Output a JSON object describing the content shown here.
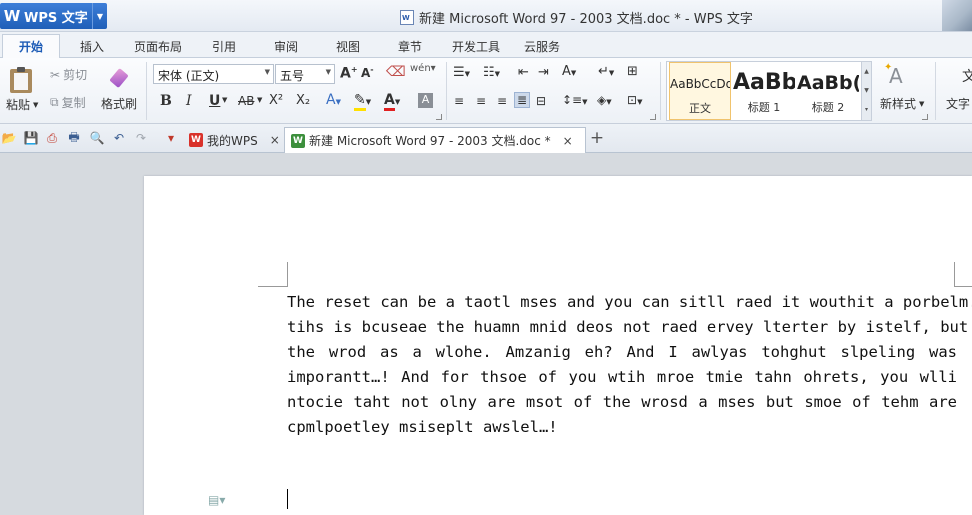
{
  "app": {
    "brand_logo": "W",
    "brand_name": "WPS 文字",
    "window_title": "新建 Microsoft Word 97 - 2003 文档.doc * - WPS 文字"
  },
  "menu": {
    "tabs": [
      "开始",
      "插入",
      "页面布局",
      "引用",
      "审阅",
      "视图",
      "章节",
      "开发工具",
      "云服务"
    ]
  },
  "ribbon": {
    "paste_label": "粘贴",
    "cut_label": "剪切",
    "copy_label": "复制",
    "format_painter_label": "格式刷",
    "font_name": "宋体 (正文)",
    "font_size": "五号",
    "bold": "B",
    "italic": "I",
    "underline": "U",
    "strike": "AB",
    "superscript": "X²",
    "subscript": "X₂",
    "styles": [
      {
        "sample": "AaBbCcDd",
        "label": "正文"
      },
      {
        "sample": "AaBb",
        "label": "标题 1"
      },
      {
        "sample": "AaBb(",
        "label": "标题 2"
      }
    ],
    "new_style_label": "新样式",
    "text_tools_label": "文字"
  },
  "tabs_bar": {
    "home_tab": "我的WPS",
    "doc_tab": "新建 Microsoft Word 97 - 2003 文档.doc *",
    "close": "×",
    "new_tab": "+"
  },
  "document": {
    "lines": [
      "The reset can be a taotl mses and you can sitll raed it wouthit a porbelm.",
      "tihs is bcuseae the huamn mnid deos not raed ervey lterter by istelf, but",
      "the wrod as a wlohe. Amzanig eh? And I awlyas tohghut slpeling was",
      "imporantt…! And for thsoe of you wtih mroe tmie tahn ohrets, you wlli",
      "ntocie taht not olny are msot of the wrosd a mses but smoe of tehm are",
      "cpmlpoetley msiseplt awslel…!"
    ]
  },
  "colors": {
    "brand_blue": "#2566c4",
    "active_tab_text": "#1c5bb6"
  }
}
